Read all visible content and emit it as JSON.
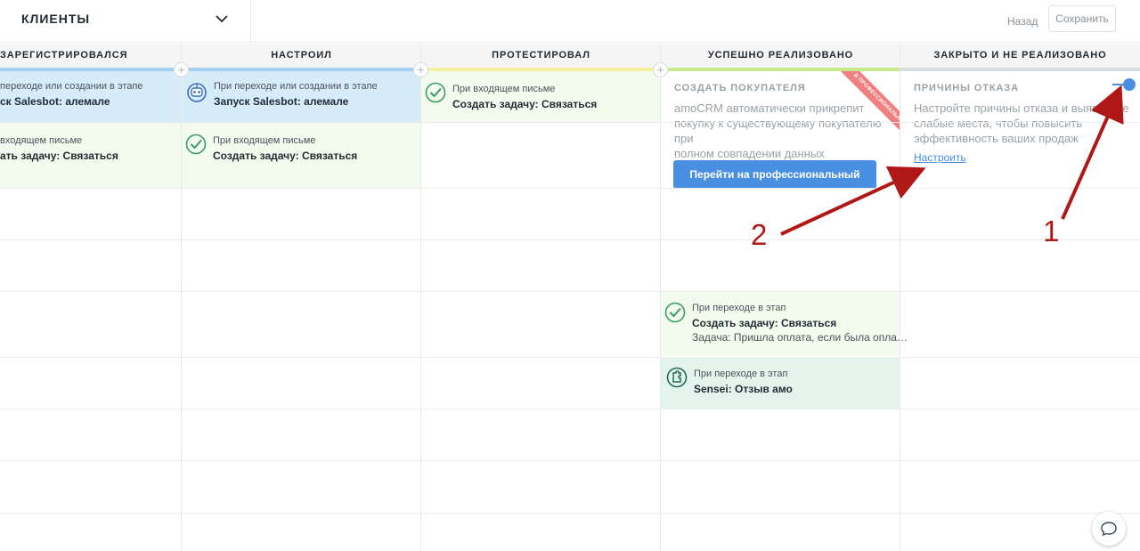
{
  "header": {
    "pipeline_name": "КЛИЕНТЫ",
    "back_label": "Назад",
    "save_label": "Сохранить"
  },
  "columns": [
    {
      "title": "ЗАРЕГИСТРИРОВАЛСЯ",
      "color": "#a6d0f2"
    },
    {
      "title": "НАСТРОИЛ",
      "color": "#a6d0f2"
    },
    {
      "title": "ПРОТЕСТИРОВАЛ",
      "color": "#f5f0a0"
    },
    {
      "title": "УСПЕШНО РЕАЛИЗОВАНО",
      "color": "#c6ec8c"
    },
    {
      "title": "ЗАКРЫТО И НЕ РЕАЛИЗОВАНО",
      "color": "#d9dcde"
    }
  ],
  "col1": {
    "salesbot": {
      "trigger": "переходе или создании в этапе",
      "action": "ск Salesbot: алемале"
    },
    "email": {
      "trigger": "входящем письме",
      "action": "ать задачу: Связаться"
    }
  },
  "col2": {
    "salesbot": {
      "trigger": "При переходе или создании в этапе",
      "action": "Запуск Salesbot: алемале",
      "icon": "robot-icon"
    },
    "email": {
      "trigger": "При входящем письме",
      "action": "Создать задачу: Связаться",
      "icon": "check-circle-icon"
    }
  },
  "col3": {
    "email": {
      "trigger": "При входящем письме",
      "action": "Создать задачу: Связаться",
      "icon": "check-circle-icon"
    }
  },
  "col4": {
    "promo": {
      "title": "СОЗДАТЬ ПОКУПАТЕЛЯ",
      "desc_line1": "amoCRM автоматически прикрепит",
      "desc_line2": "покупку к существующему покупателю при",
      "desc_line3": "полном совпадении данных",
      "button": "Перейти на профессиональный тариф",
      "ribbon": "В ПРОФЕССИОНАЛЬНОМ"
    },
    "task": {
      "trigger": "При переходе в этап",
      "action": "Создать задачу: Связаться",
      "detail": "Задача: Пришла оплата, если была опла…",
      "icon": "check-circle-icon"
    },
    "sensei": {
      "trigger": "При переходе в этап",
      "action": "Sensei: Отзыв амо",
      "icon": "puzzle-icon"
    }
  },
  "col5": {
    "reasons": {
      "title": "ПРИЧИНЫ ОТКАЗА",
      "desc_line1": "Настройте причины отказа и выявляйте",
      "desc_line2": "слабые места, чтобы повысить",
      "desc_line3": "эффективность ваших продаж",
      "link": "Настроить",
      "toggle_on": true
    }
  },
  "annotations": {
    "label1": "1",
    "label2": "2",
    "color": "#b01818"
  },
  "chat": {
    "icon": "chat-bubble-icon"
  }
}
